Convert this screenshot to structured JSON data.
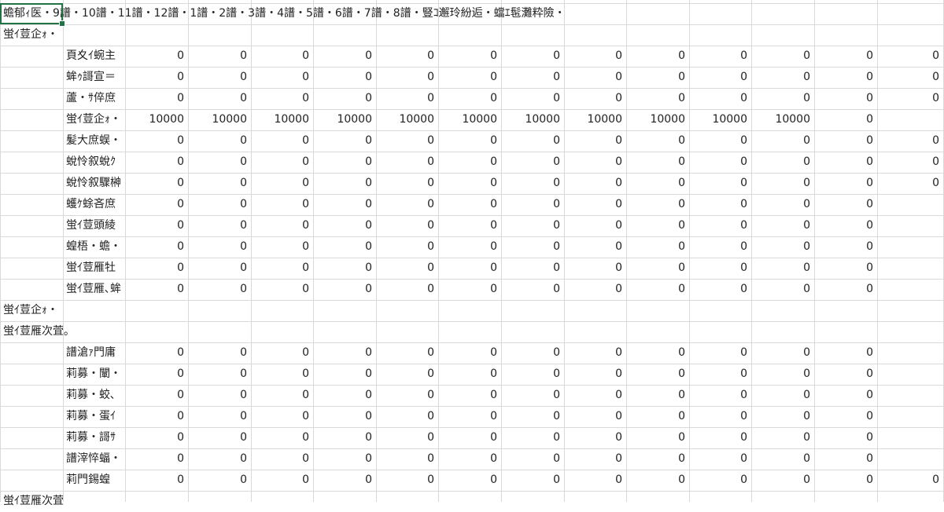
{
  "sheet": {
    "header_row_text": "蟾郁ｨ医・9譜・10譜・11譜・12譜・1譜・2譜・3譜・4譜・5譜・6譜・7譜・8譜・豎ｺ邂玲紛逅・蟷ｴ髢灘粋險・",
    "rows": [
      {
        "type": "section",
        "label": "蛍ｲ荳企ｫ・"
      },
      {
        "type": "data",
        "label": "頁夊ｲ蜿主",
        "values": [
          "0",
          "0",
          "0",
          "0",
          "0",
          "0",
          "0",
          "0",
          "0",
          "0",
          "0",
          "0",
          "0"
        ]
      },
      {
        "type": "data",
        "label": "蛑ｩ謌宣＝",
        "values": [
          "0",
          "0",
          "0",
          "0",
          "0",
          "0",
          "0",
          "0",
          "0",
          "0",
          "0",
          "0",
          "0"
        ]
      },
      {
        "type": "data",
        "label": "蘆・ｻ倅庶",
        "values": [
          "0",
          "0",
          "0",
          "0",
          "0",
          "0",
          "0",
          "0",
          "0",
          "0",
          "0",
          "0",
          "0"
        ]
      },
      {
        "type": "data",
        "label": "蛍ｲ荳企ｫ・",
        "values": [
          "10000",
          "10000",
          "10000",
          "10000",
          "10000",
          "10000",
          "10000",
          "10000",
          "10000",
          "10000",
          "10000",
          "0",
          ""
        ]
      },
      {
        "type": "data",
        "label": "髪大庶蜈・",
        "values": [
          "0",
          "0",
          "0",
          "0",
          "0",
          "0",
          "0",
          "0",
          "0",
          "0",
          "0",
          "0",
          "0"
        ]
      },
      {
        "type": "data",
        "label": "蛻怜叙蛻ｸ",
        "values": [
          "0",
          "0",
          "0",
          "0",
          "0",
          "0",
          "0",
          "0",
          "0",
          "0",
          "0",
          "0",
          "0"
        ]
      },
      {
        "type": "data",
        "label": "蛻怜叙驟榊",
        "values": [
          "0",
          "0",
          "0",
          "0",
          "0",
          "0",
          "0",
          "0",
          "0",
          "0",
          "0",
          "0",
          "0"
        ]
      },
      {
        "type": "data",
        "label": "蠖ｹ蜍吝庶",
        "values": [
          "0",
          "0",
          "0",
          "0",
          "0",
          "0",
          "0",
          "0",
          "0",
          "0",
          "0",
          "0",
          ""
        ]
      },
      {
        "type": "data",
        "label": "蛍ｲ荳頭綾",
        "values": [
          "0",
          "0",
          "0",
          "0",
          "0",
          "0",
          "0",
          "0",
          "0",
          "0",
          "0",
          "0",
          ""
        ]
      },
      {
        "type": "data",
        "label": "蝗梧・蟾・",
        "values": [
          "0",
          "0",
          "0",
          "0",
          "0",
          "0",
          "0",
          "0",
          "0",
          "0",
          "0",
          "0",
          ""
        ]
      },
      {
        "type": "data",
        "label": "蛍ｲ荳雁牡",
        "values": [
          "0",
          "0",
          "0",
          "0",
          "0",
          "0",
          "0",
          "0",
          "0",
          "0",
          "0",
          "0",
          ""
        ]
      },
      {
        "type": "data",
        "label": "蛍ｲ荳雁､蛑",
        "values": [
          "0",
          "0",
          "0",
          "0",
          "0",
          "0",
          "0",
          "0",
          "0",
          "0",
          "0",
          "0",
          ""
        ]
      },
      {
        "type": "section",
        "label": "蛍ｲ荳企ｫ・"
      },
      {
        "type": "section",
        "label": "蛍ｲ荳雁次萓｡"
      },
      {
        "type": "data",
        "label": "譜滄ｧ門庸",
        "values": [
          "0",
          "0",
          "0",
          "0",
          "0",
          "0",
          "0",
          "0",
          "0",
          "0",
          "0",
          "0",
          ""
        ]
      },
      {
        "type": "data",
        "label": "莉募・闡・",
        "values": [
          "0",
          "0",
          "0",
          "0",
          "0",
          "0",
          "0",
          "0",
          "0",
          "0",
          "0",
          "0",
          ""
        ]
      },
      {
        "type": "data",
        "label": "莉募・蛟､",
        "values": [
          "0",
          "0",
          "0",
          "0",
          "0",
          "0",
          "0",
          "0",
          "0",
          "0",
          "0",
          "0",
          ""
        ]
      },
      {
        "type": "data",
        "label": "莉募・蛋ｲ",
        "values": [
          "0",
          "0",
          "0",
          "0",
          "0",
          "0",
          "0",
          "0",
          "0",
          "0",
          "0",
          "0",
          ""
        ]
      },
      {
        "type": "data",
        "label": "莉募・謌ｻ",
        "values": [
          "0",
          "0",
          "0",
          "0",
          "0",
          "0",
          "0",
          "0",
          "0",
          "0",
          "0",
          "0",
          ""
        ]
      },
      {
        "type": "data",
        "label": "譜滓悴蝠・",
        "values": [
          "0",
          "0",
          "0",
          "0",
          "0",
          "0",
          "0",
          "0",
          "0",
          "0",
          "0",
          "0",
          ""
        ]
      },
      {
        "type": "data",
        "label": "莉門錫蝗",
        "values": [
          "0",
          "0",
          "0",
          "0",
          "0",
          "0",
          "0",
          "0",
          "0",
          "0",
          "0",
          "0",
          "0"
        ]
      },
      {
        "type": "section",
        "label": "蛍ｲ荳雁次萓"
      }
    ]
  }
}
